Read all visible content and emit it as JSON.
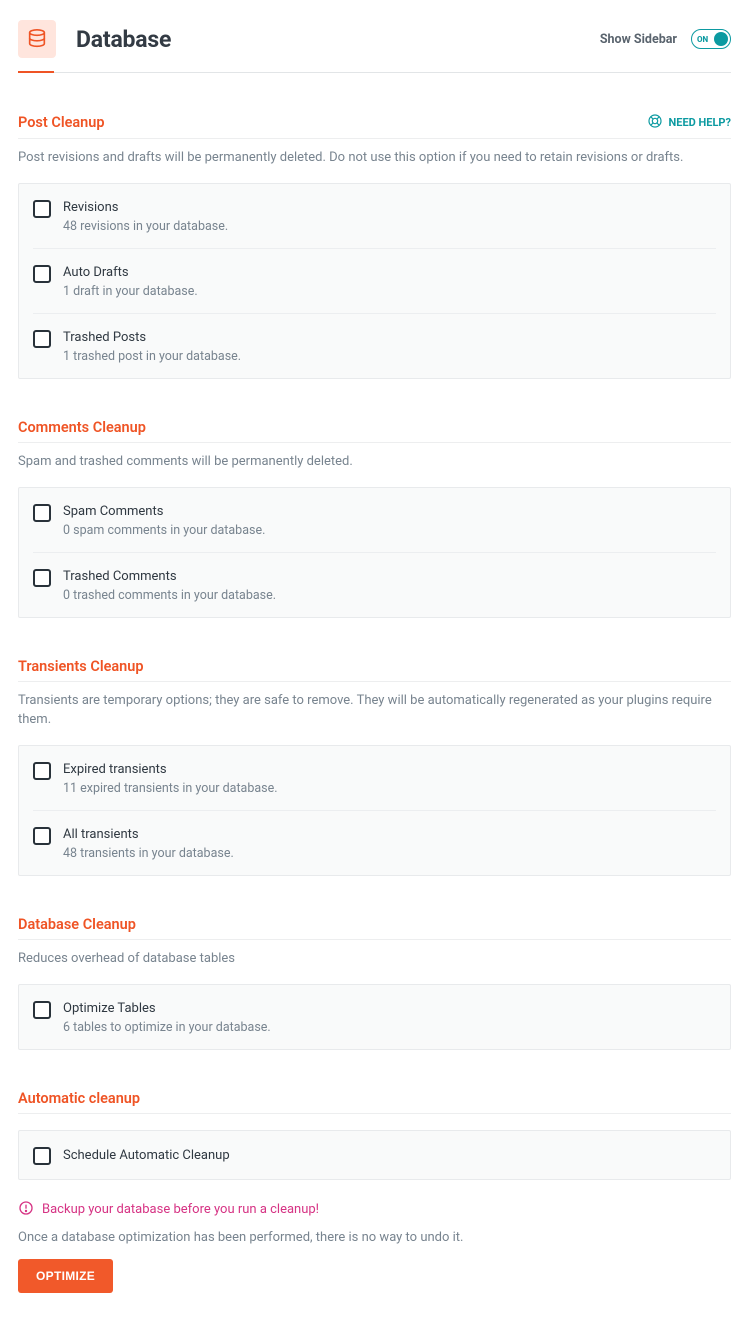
{
  "header": {
    "title": "Database",
    "show_sidebar_label": "Show Sidebar",
    "switch_label": "ON"
  },
  "help_label": "NEED HELP?",
  "sections": {
    "post_cleanup": {
      "title": "Post Cleanup",
      "desc": "Post revisions and drafts will be permanently deleted. Do not use this option if you need to retain revisions or drafts.",
      "items": [
        {
          "label": "Revisions",
          "sub": "48 revisions in your database."
        },
        {
          "label": "Auto Drafts",
          "sub": "1 draft in your database."
        },
        {
          "label": "Trashed Posts",
          "sub": "1 trashed post in your database."
        }
      ]
    },
    "comments_cleanup": {
      "title": "Comments Cleanup",
      "desc": "Spam and trashed comments will be permanently deleted.",
      "items": [
        {
          "label": "Spam Comments",
          "sub": "0 spam comments in your database."
        },
        {
          "label": "Trashed Comments",
          "sub": "0 trashed comments in your database."
        }
      ]
    },
    "transients_cleanup": {
      "title": "Transients Cleanup",
      "desc": "Transients are temporary options; they are safe to remove. They will be automatically regenerated as your plugins require them.",
      "items": [
        {
          "label": "Expired transients",
          "sub": "11 expired transients in your database."
        },
        {
          "label": "All transients",
          "sub": "48 transients in your database."
        }
      ]
    },
    "database_cleanup": {
      "title": "Database Cleanup",
      "desc": "Reduces overhead of database tables",
      "items": [
        {
          "label": "Optimize Tables",
          "sub": "6 tables to optimize in your database."
        }
      ]
    },
    "automatic_cleanup": {
      "title": "Automatic cleanup",
      "items": [
        {
          "label": "Schedule Automatic Cleanup"
        }
      ]
    }
  },
  "footer": {
    "warning": "Backup your database before you run a cleanup!",
    "note": "Once a database optimization has been performed, there is no way to undo it.",
    "button": "OPTIMIZE"
  }
}
